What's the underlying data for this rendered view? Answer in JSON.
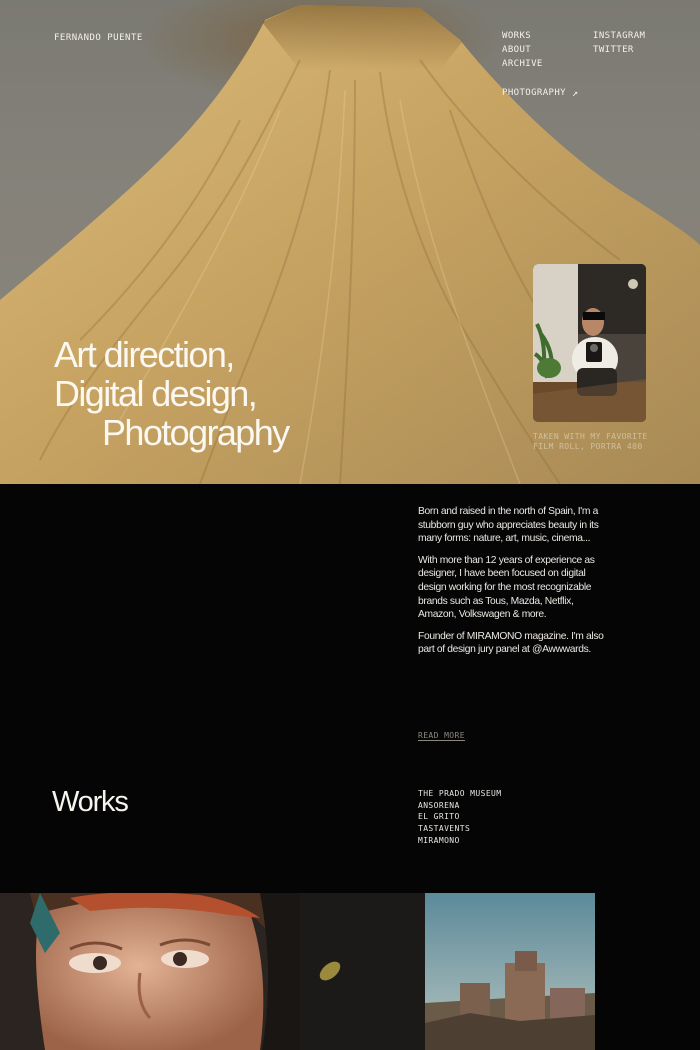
{
  "header": {
    "brand": "FERNANDO PUENTE",
    "nav_primary": [
      "WORKS",
      "ABOUT",
      "ARCHIVE"
    ],
    "nav_social": [
      "INSTAGRAM",
      "TWITTER"
    ],
    "photography_link": "PHOTOGRAPHY",
    "photography_icon": "↗"
  },
  "hero": {
    "headline_lines": [
      "Art direction,",
      "Digital design,",
      "Photography"
    ],
    "photo_caption_lines": [
      "TAKEN WITH MY FAVORITE",
      "FILM ROLL, PORTRA 400"
    ]
  },
  "about": {
    "paragraphs": [
      "Born and raised in the north of Spain, I'm a stubborn guy who appreciates beauty in its many forms: nature, art, music, cinema...",
      "With more than 12 years of experience as designer, I have been focused on digital design working for the most recognizable brands such as Tous, Mazda, Netflix, Amazon, Volkswagen & more.",
      "Founder of MIRAMONO magazine. I'm also part of design jury panel at @Awwwards."
    ],
    "read_more": "READ MORE"
  },
  "works": {
    "title": "Works",
    "items": [
      "THE PRADO MUSEUM",
      "ANSORENA",
      "EL GRITO",
      "TASTAVENTS",
      "MIRAMONO"
    ]
  },
  "colors": {
    "background": "#050506",
    "hero_sky": "#85827a",
    "rock": "#c9a764",
    "text": "#f2efe9"
  }
}
